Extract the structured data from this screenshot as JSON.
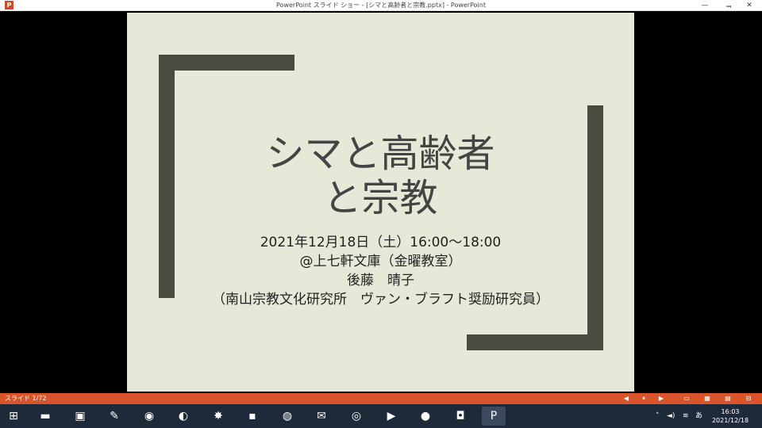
{
  "window": {
    "title": "PowerPoint スライド ショー - [シマと高齢者と宗教.pptx] - PowerPoint",
    "controls": [
      "—",
      "ᆿ",
      "✕"
    ]
  },
  "slide": {
    "title_line1": "シマと高齢者",
    "title_line2": "と宗教",
    "sub_lines": [
      "2021年12月18日（土）16:00～18:00",
      "@上七軒文庫（金曜教室）",
      "後藤　晴子",
      "（南山宗教文化研究所　ヴァン・ブラフト奨励研究員）"
    ]
  },
  "status": {
    "slide_counter": "スライド 1/72"
  },
  "taskbar": {
    "time": "16:03",
    "date": "2021/12/18"
  },
  "colors": {
    "accent": "#d9542b",
    "slide_bg": "#e6e8d8",
    "bracket": "#4a4b40"
  }
}
